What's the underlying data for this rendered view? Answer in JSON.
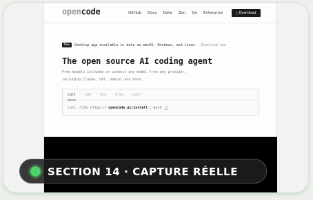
{
  "header": {
    "logo_light": "open",
    "logo_bold": "code",
    "nav": [
      "GitHub",
      "Docs",
      "Data",
      "Zen",
      "Go",
      "Enterprise"
    ],
    "download_label": "Download",
    "download_icon": "download-arrow-icon"
  },
  "announcement": {
    "badge": "New",
    "message": "Desktop app available in beta on macOS, Windows, and Linux.",
    "link": "Download now"
  },
  "hero": {
    "title": "The open source AI coding agent",
    "subtitle_line1": "Free models included or connect any model from any provider,",
    "subtitle_line2": "including Claude, GPT, Gemini and more."
  },
  "install": {
    "tabs": [
      "curl",
      "npm",
      "bun",
      "brew",
      "paru"
    ],
    "active_tab": "curl",
    "command_prefix": "curl -fsSL https://",
    "command_url": "opencode.ai/install",
    "command_suffix": "| bash",
    "copy_icon": "copy-icon"
  },
  "overlay": {
    "label": "SECTION 14 · CAPTURE RÉELLE",
    "status_color": "#4bd06a"
  }
}
